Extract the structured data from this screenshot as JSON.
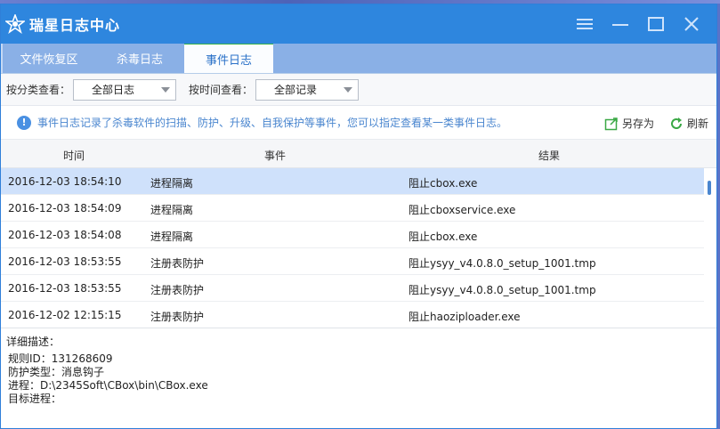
{
  "app": {
    "title": "瑞星日志中心"
  },
  "tabs": [
    {
      "label": "文件恢复区",
      "active": false
    },
    {
      "label": "杀毒日志",
      "active": false
    },
    {
      "label": "事件日志",
      "active": true
    }
  ],
  "filters": {
    "category_label": "按分类查看：",
    "category_value": "全部日志",
    "time_label": "按时间查看：",
    "time_value": "全部记录"
  },
  "info": {
    "text": "事件日志记录了杀毒软件的扫描、防护、升级、自我保护等事件，您可以指定查看某一类事件日志。",
    "save_as": "另存为",
    "refresh": "刷新"
  },
  "table": {
    "headers": [
      "时间",
      "事件",
      "结果"
    ],
    "rows": [
      {
        "time": "2016-12-03 18:54:10",
        "event": "进程隔离",
        "result": "阻止cbox.exe",
        "selected": true
      },
      {
        "time": "2016-12-03 18:54:09",
        "event": "进程隔离",
        "result": "阻止cboxservice.exe",
        "selected": false
      },
      {
        "time": "2016-12-03 18:54:08",
        "event": "进程隔离",
        "result": "阻止cbox.exe",
        "selected": false
      },
      {
        "time": "2016-12-03 18:53:55",
        "event": "注册表防护",
        "result": "阻止ysyy_v4.0.8.0_setup_1001.tmp",
        "selected": false
      },
      {
        "time": "2016-12-03 18:53:55",
        "event": "注册表防护",
        "result": "阻止ysyy_v4.0.8.0_setup_1001.tmp",
        "selected": false
      },
      {
        "time": "2016-12-02 12:15:15",
        "event": "注册表防护",
        "result": "阻止haoziploader.exe",
        "selected": false
      }
    ]
  },
  "detail": {
    "title": "详细描述：",
    "lines": [
      "规则ID：131268609",
      "防护类型：消息钩子",
      "进程：D:\\2345Soft\\CBox\\bin\\CBox.exe",
      "目标进程："
    ]
  },
  "colors": {
    "titlebar": "#2e86de",
    "accent": "#38b14a",
    "selected_row": "#cfe1fb"
  }
}
